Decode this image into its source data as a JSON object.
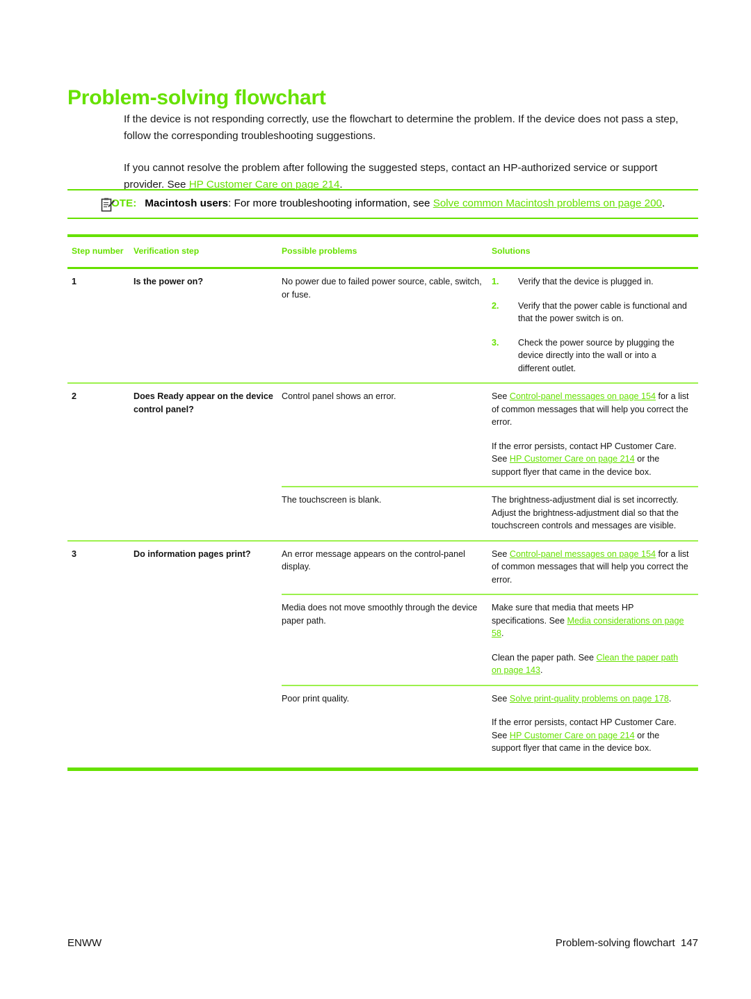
{
  "document": {
    "title": "Problem-solving flowchart"
  },
  "intro": {
    "paragraph1": "If the device is not responding correctly, use the flowchart to determine the problem. If the device does not pass a step, follow the corresponding troubleshooting suggestions.",
    "paragraph2_pre": "If you cannot resolve the problem after following the suggested steps, contact an HP-authorized service or support provider. See ",
    "paragraph2_link": "HP Customer Care on page 214",
    "paragraph2_post": "."
  },
  "note": {
    "icon": "note-clipboard-icon",
    "label": "NOTE:",
    "strong": "Macintosh users",
    "text_mid": ": For more troubleshooting information, see ",
    "link": "Solve common Macintosh problems on page 200",
    "text_post": "."
  },
  "table": {
    "headers": {
      "col1": "Step number",
      "col2": "Verification step",
      "col3": "Possible problems",
      "col4": "Solutions"
    },
    "rows": [
      {
        "step": "1",
        "verification": "Is the power on?",
        "problem": "No power due to failed power source, cable, switch, or fuse.",
        "solution_list": [
          {
            "num": "1.",
            "text": "Verify that the device is plugged in."
          },
          {
            "num": "2.",
            "text": "Verify that the power cable is functional and that the power switch is on."
          },
          {
            "num": "3.",
            "text": "Check the power source by plugging the device directly into the wall or into a different outlet."
          }
        ]
      },
      {
        "step": "2",
        "verification": "Does Ready appear on the device control panel?",
        "problem": "Control panel shows an error.",
        "solution_p1_pre": "See ",
        "solution_p1_link": "Control-panel messages on page 154",
        "solution_p1_post": " for a list of common messages that will help you correct the error.",
        "solution_p2_pre": "If the error persists, contact HP Customer Care. See ",
        "solution_p2_link": "HP Customer Care on page 214",
        "solution_p2_post": " or the support flyer that came in the device box."
      },
      {
        "step": "",
        "verification": "",
        "problem": "The touchscreen is blank.",
        "solution_plain": "The brightness-adjustment dial is set incorrectly. Adjust the brightness-adjustment dial so that the touchscreen controls and messages are visible."
      },
      {
        "step": "3",
        "verification": "Do information pages print?",
        "problem": "An error message appears on the control-panel display.",
        "solution_p1_pre": "See ",
        "solution_p1_link": "Control-panel messages on page 154",
        "solution_p1_post": " for a list of common messages that will help you correct the error."
      },
      {
        "step": "",
        "verification": "",
        "problem": "Media does not move smoothly through the device paper path.",
        "solution_p1_pre": "Make sure that media that meets HP specifications. See ",
        "solution_p1_link": "Media considerations on page 58",
        "solution_p1_post": ".",
        "solution_p2_pre": "Clean the paper path. See ",
        "solution_p2_link": "Clean the paper path on page 143",
        "solution_p2_post": "."
      },
      {
        "step": "",
        "verification": "",
        "problem": "Poor print quality.",
        "solution_p1_pre": "See ",
        "solution_p1_link": "Solve print-quality problems on page 178",
        "solution_p1_post": ".",
        "solution_p2_pre": "If the error persists, contact HP Customer Care. See ",
        "solution_p2_link": "HP Customer Care on page 214",
        "solution_p2_post": " or the support flyer that came in the device box."
      }
    ]
  },
  "footer": {
    "left": "ENWW",
    "right": "Problem-solving flowchart  147"
  },
  "colors": {
    "accent_green": "#66e100",
    "rule_light_green": "#9cf14d",
    "body_text": "#141414"
  }
}
